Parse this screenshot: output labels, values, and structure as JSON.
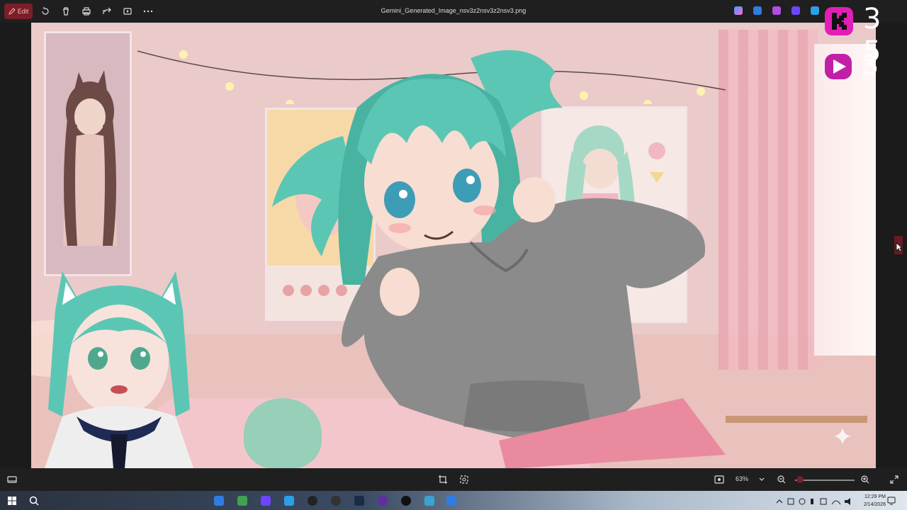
{
  "titlebar": {
    "edit_label": "Edit",
    "filename": "Gemini_Generated_Image_nsv3z2nsv3z2nsv3.png"
  },
  "overlay": {
    "k_count": "3 5",
    "p_count": "3"
  },
  "bottombar": {
    "zoom_level": "63%"
  },
  "taskbar": {
    "time": "12:29 PM",
    "date": "2/14/2026"
  },
  "colors": {
    "accent": "#7a1f27",
    "overlay_magenta": "#e21fb5"
  }
}
